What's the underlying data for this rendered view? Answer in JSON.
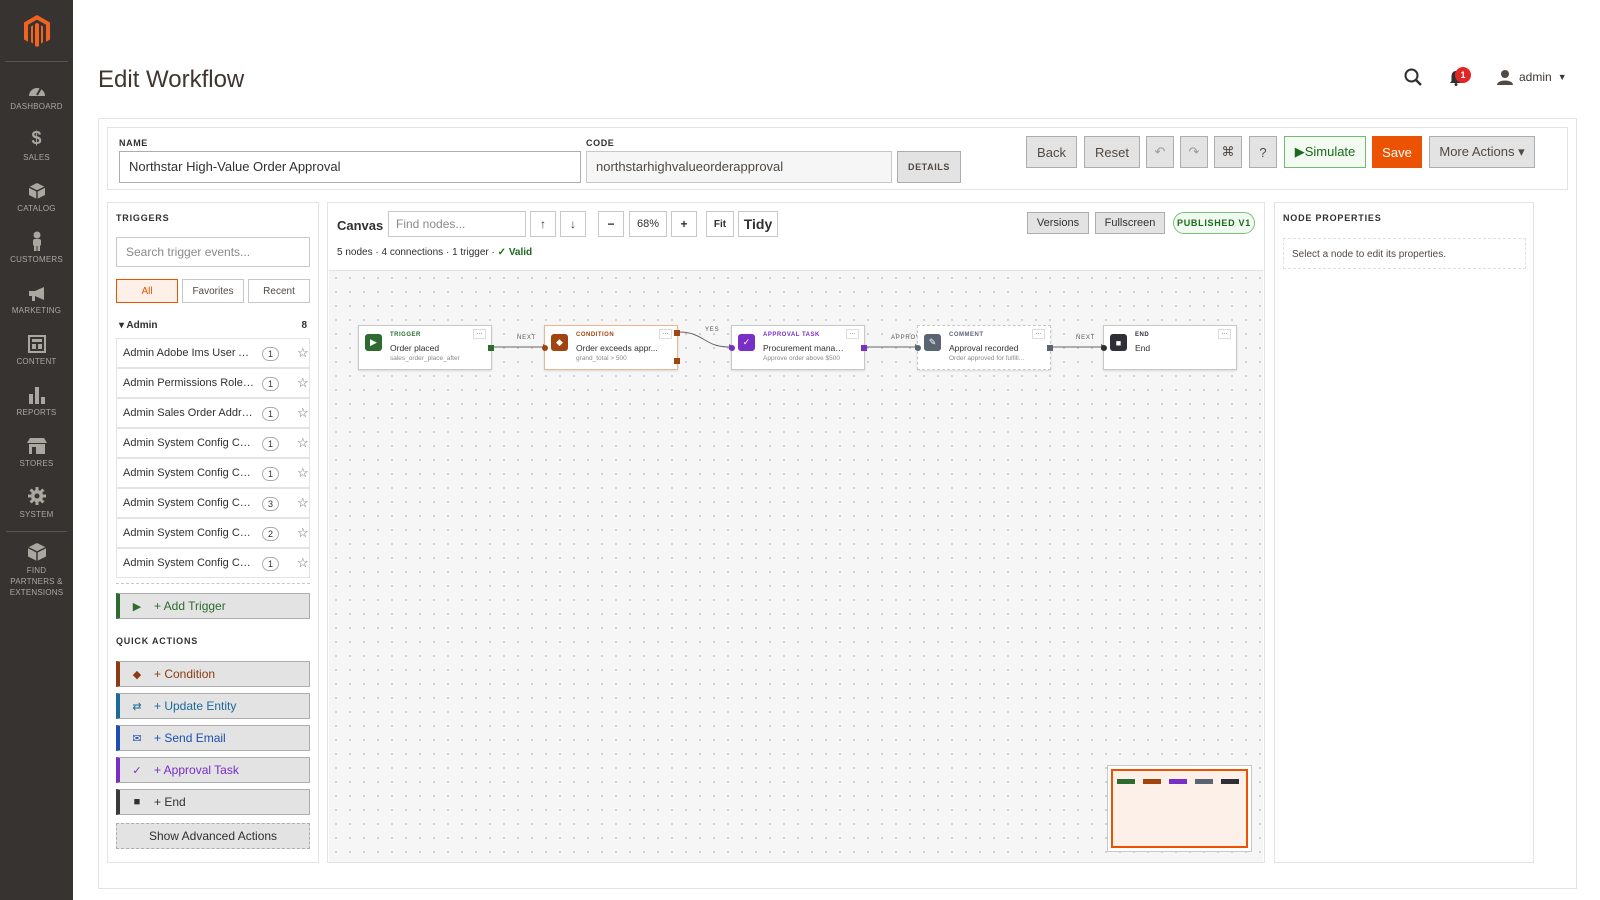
{
  "nav": {
    "items": [
      {
        "label": "DASHBOARD",
        "icon": "dashboard-icon"
      },
      {
        "label": "SALES",
        "icon": "dollar-icon"
      },
      {
        "label": "CATALOG",
        "icon": "box-icon"
      },
      {
        "label": "CUSTOMERS",
        "icon": "person-icon"
      },
      {
        "label": "MARKETING",
        "icon": "megaphone-icon"
      },
      {
        "label": "CONTENT",
        "icon": "layout-icon"
      },
      {
        "label": "REPORTS",
        "icon": "bar-chart-icon"
      },
      {
        "label": "STORES",
        "icon": "store-icon"
      },
      {
        "label": "SYSTEM",
        "icon": "gear-icon"
      },
      {
        "label": "FIND PARTNERS & EXTENSIONS",
        "icon": "cube-icon"
      }
    ]
  },
  "header": {
    "title": "Edit Workflow",
    "notification_count": "1",
    "user": "admin"
  },
  "form": {
    "name_label": "NAME",
    "name_value": "Northstar High-Value Order Approval",
    "code_label": "CODE",
    "code_value": "northstarhighvalueorderapproval",
    "details_label": "DETAILS"
  },
  "toolbar": {
    "back": "Back",
    "reset": "Reset",
    "undo": "↶",
    "redo": "↷",
    "shortcuts": "⌘",
    "help": "?",
    "simulate": "▶Simulate",
    "save": "Save",
    "more": "More Actions ▾"
  },
  "triggers": {
    "title": "TRIGGERS",
    "search_placeholder": "Search trigger events...",
    "tabs": [
      "All",
      "Favorites",
      "Recent"
    ],
    "group_name": "▾ Admin",
    "group_count": "8",
    "items": [
      {
        "name": "Admin Adobe Ims User Au...",
        "count": "1"
      },
      {
        "name": "Admin Permissions Role P...",
        "count": "1"
      },
      {
        "name": "Admin Sales Order Addre...",
        "count": "1"
      },
      {
        "name": "Admin System Config Cha...",
        "count": "1"
      },
      {
        "name": "Admin System Config Cha...",
        "count": "1"
      },
      {
        "name": "Admin System Config Cha...",
        "count": "3"
      },
      {
        "name": "Admin System Config Cha...",
        "count": "2"
      },
      {
        "name": "Admin System Config Cha...",
        "count": "1"
      }
    ],
    "add_trigger": "+ Add Trigger"
  },
  "quick_actions": {
    "title": "QUICK ACTIONS",
    "condition": "+ Condition",
    "update_entity": "+ Update Entity",
    "send_email": "+ Send Email",
    "approval_task": "+ Approval Task",
    "end": "+ End",
    "advanced": "Show Advanced Actions"
  },
  "canvas": {
    "title": "Canvas",
    "find_placeholder": "Find nodes...",
    "up": "↑",
    "down": "↓",
    "zoom_out": "−",
    "zoom": "68%",
    "zoom_in": "+",
    "fit": "Fit",
    "tidy": "Tidy",
    "versions": "Versions",
    "fullscreen": "Fullscreen",
    "status": "PUBLISHED V1",
    "stats": "5 nodes · 4 connections · 1 trigger ·",
    "valid": "✓ Valid",
    "nodes": [
      {
        "type": "TRIGGER",
        "name": "Order placed",
        "sub": "sales_order_place_after",
        "color": "#2e6b2e",
        "icon": "▶"
      },
      {
        "type": "CONDITION",
        "name": "Order exceeds appr...",
        "sub": "grand_total > 500",
        "color": "#a0450f",
        "icon": "◆"
      },
      {
        "type": "APPROVAL TASK",
        "name": "Procurement manag...",
        "sub": "Approve order above $500",
        "color": "#7a2ec8",
        "icon": "✓"
      },
      {
        "type": "COMMENT",
        "name": "Approval recorded",
        "sub": "Order approved for fulfill...",
        "color": "#5a6472",
        "icon": "✎"
      },
      {
        "type": "END",
        "name": "End",
        "sub": "",
        "color": "#2f2f38",
        "icon": "■"
      }
    ],
    "edges": [
      "NEXT",
      "YES",
      "APPROV",
      "NEXT"
    ]
  },
  "properties": {
    "title": "NODE PROPERTIES",
    "empty": "Select a node to edit its properties."
  }
}
